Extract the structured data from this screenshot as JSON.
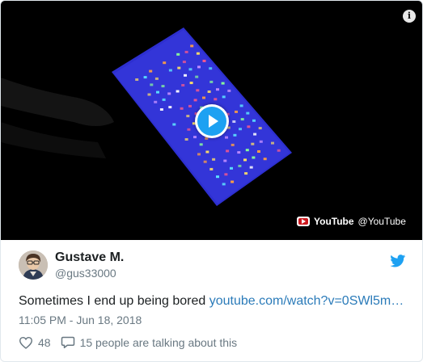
{
  "video": {
    "source_brand": "YouTube",
    "source_handle": "@YouTube",
    "info_glyph": "i",
    "background_color": "#000000",
    "phone_screen_color": "#2d2fd0"
  },
  "author": {
    "display_name": "Gustave M.",
    "handle": "@gus33000"
  },
  "tweet": {
    "text": "Sometimes I end up being bored ",
    "link_text": "youtube.com/watch?v=0SWl5m…",
    "timestamp": "11:05 PM - Jun 18, 2018"
  },
  "actions": {
    "like_count": "48",
    "talk_text": "15 people are talking about this"
  },
  "colors": {
    "link": "#2b7bb9",
    "muted": "#697882",
    "twitter_blue": "#1da1f2"
  }
}
